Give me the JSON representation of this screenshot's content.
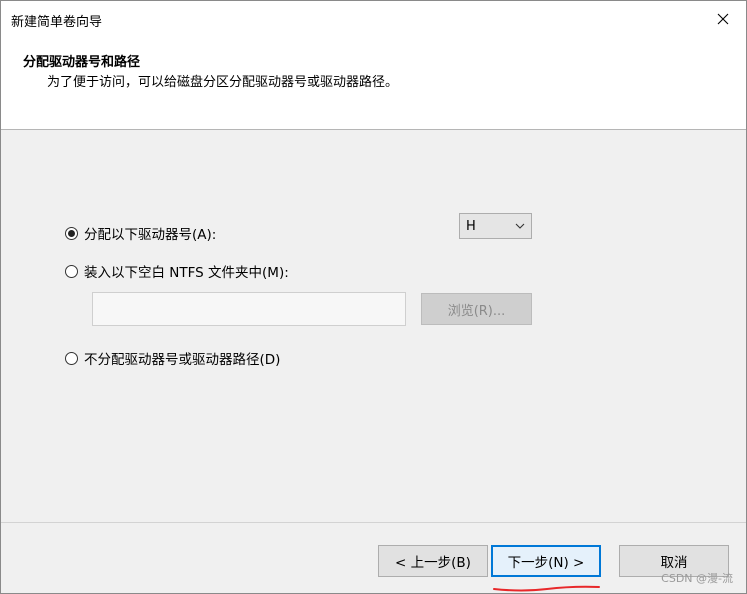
{
  "window": {
    "title": "新建简单卷向导",
    "close_icon": "close-icon"
  },
  "header": {
    "title": "分配驱动器号和路径",
    "subtitle": "为了便于访问，可以给磁盘分区分配驱动器号或驱动器路径。"
  },
  "options": {
    "assign_letter": {
      "label": "分配以下驱动器号(A):",
      "checked": true
    },
    "mount_folder": {
      "label": "装入以下空白 NTFS 文件夹中(M):",
      "checked": false
    },
    "no_assign": {
      "label": "不分配驱动器号或驱动器路径(D)",
      "checked": false
    }
  },
  "drive_letter": {
    "selected": "H"
  },
  "folder_path": {
    "value": ""
  },
  "browse_button": {
    "label": "浏览(R)..."
  },
  "footer": {
    "back_label": "< 上一步(B)",
    "next_label": "下一步(N) >",
    "cancel_label": "取消"
  },
  "annotation": {
    "color": "#e8282a"
  },
  "watermark": "CSDN @漫-流"
}
